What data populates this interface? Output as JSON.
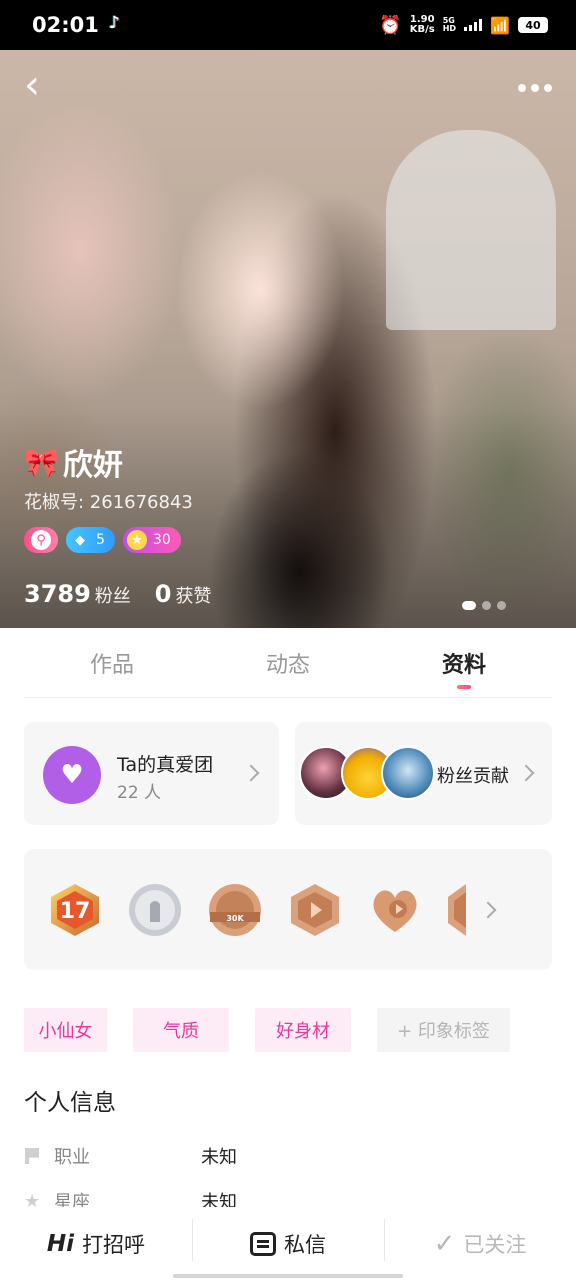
{
  "status_bar": {
    "time": "02:01",
    "net_speed_value": "1.90",
    "net_speed_unit": "KB/s",
    "network_top": "5G",
    "network_bottom": "HD",
    "battery": "40"
  },
  "profile": {
    "name": "欣妍",
    "id_text": "花椒号: 261676843",
    "badges": [
      {
        "kind": "key-icon"
      },
      {
        "kind": "diamond-icon",
        "value": "5"
      },
      {
        "kind": "star-icon",
        "value": "30"
      }
    ],
    "fans_count": "3789",
    "fans_label": "粉丝",
    "likes_count": "0",
    "likes_label": "获赞"
  },
  "tabs": [
    {
      "label": "作品",
      "active": false
    },
    {
      "label": "动态",
      "active": false
    },
    {
      "label": "资料",
      "active": true
    }
  ],
  "fan_club": {
    "title": "Ta的真爱团",
    "count": "22 人"
  },
  "contribution": {
    "label": "粉丝贡献"
  },
  "tags": [
    "小仙女",
    "气质",
    "好身材"
  ],
  "add_tag_label": "+ 印象标签",
  "personal_info": {
    "title": "个人信息",
    "rows": [
      {
        "key": "职业",
        "value": "未知"
      },
      {
        "key": "星座",
        "value": "未知"
      }
    ]
  },
  "bottom_bar": {
    "greet_icon": "Hi",
    "greet_label": "打招呼",
    "message_label": "私信",
    "followed_label": "已关注"
  },
  "colors": {
    "accent_pink": "#e9389b",
    "tag_bg": "#fdecf6",
    "fanclub_purple": "#b25fe7",
    "tab_indicator": "#ff3fa0"
  }
}
